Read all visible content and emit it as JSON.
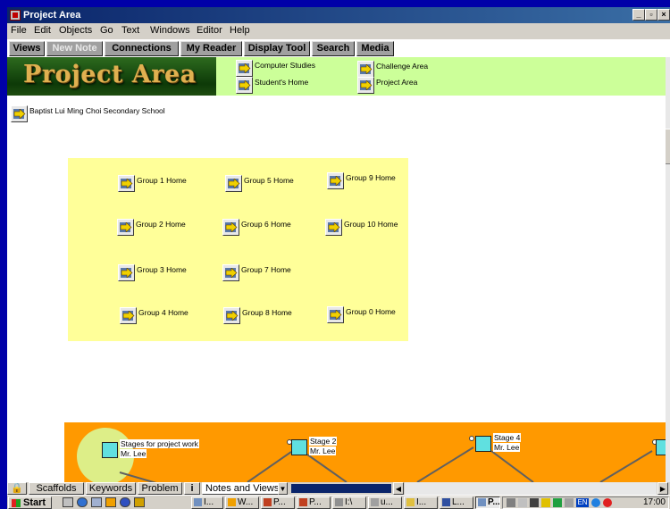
{
  "window": {
    "title": "Project Area"
  },
  "menu": [
    "File",
    "Edit",
    "Objects",
    "Go",
    "Text",
    "Windows",
    "Editor",
    "Help"
  ],
  "toolbar_tabs": [
    {
      "label": "Views",
      "enabled": true
    },
    {
      "label": "New Note",
      "enabled": false
    },
    {
      "label": "Connections",
      "enabled": true
    },
    {
      "label": "My Reader",
      "enabled": true
    },
    {
      "label": "Display Tool",
      "enabled": true
    },
    {
      "label": "Search",
      "enabled": true
    },
    {
      "label": "Media",
      "enabled": true
    }
  ],
  "banner": {
    "logo_text": "Project Area",
    "links": [
      "Computer Studies",
      "Student's Home",
      "Challenge Area",
      "Project Area"
    ]
  },
  "school_link": "Baptist Lui Ming Choi Secondary School",
  "groups": [
    "Group 1 Home",
    "Group 5 Home",
    "Group 9 Home",
    "Group 2 Home",
    "Group 6 Home",
    "Group 10 Home",
    "Group 3 Home",
    "Group 7 Home",
    "Group 4 Home",
    "Group 8 Home",
    "Group 0 Home"
  ],
  "stages": [
    {
      "title": "Stages for project work",
      "author": "Mr. Lee"
    },
    {
      "title": "Stage 2",
      "author": "Mr. Lee"
    },
    {
      "title": "Stage 4",
      "author": "Mr. Lee"
    }
  ],
  "bottom_tabs": [
    "Scaffolds",
    "Keywords",
    "Problem",
    "i",
    "Notes and Views"
  ],
  "taskbar": {
    "start_label": "Start",
    "tasks": [
      "I...",
      "W...",
      "P...",
      "P...",
      "I:\\",
      "u...",
      "I...",
      "L...",
      "P..."
    ],
    "active_task": "P...",
    "language": "EN",
    "clock": "17:00"
  },
  "colors": {
    "banner_bg": "#ccff99",
    "groups_bg": "#ffff99",
    "stages_bg": "#ff9900",
    "desktop": "#0000a8"
  }
}
